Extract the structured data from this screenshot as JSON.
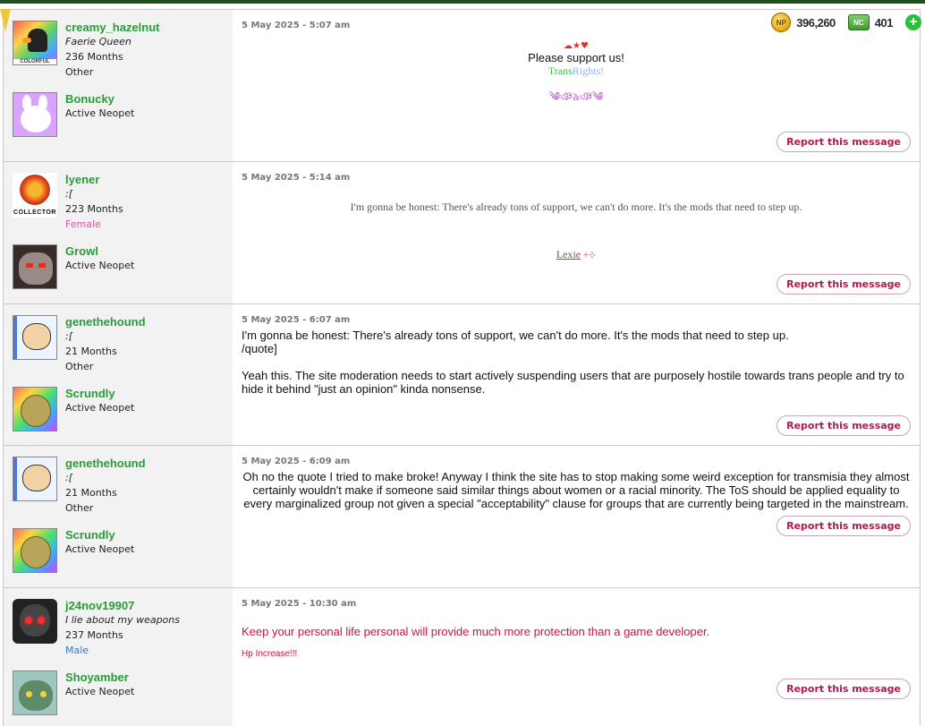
{
  "hud": {
    "neopoints": "396,260",
    "neocash": "401",
    "np_icon": "np-coin-icon",
    "nc_icon": "nc-cash-icon"
  },
  "report_label": "Report this message",
  "posts": [
    {
      "date": "5 May 2025 - 5:07 am",
      "user": {
        "name": "creamy_hazelnut",
        "title": "Faerie Queen",
        "months": "236 Months",
        "gender": "Other"
      },
      "pet": {
        "name": "Bonucky",
        "status": "Active Neopet"
      },
      "sig_icons": "☁★♥",
      "support": "Please support us!",
      "trans_word1": "Trans",
      "trans_word2": "Rights!",
      "flourish": "༄ঞ৯ঞ༄"
    },
    {
      "date": "5 May 2025 - 5:14 am",
      "user": {
        "name": "lyener",
        "title": ":[",
        "months": "223 Months",
        "gender": "Female"
      },
      "pet": {
        "name": "Growl",
        "status": "Active Neopet"
      },
      "body": "I'm gonna be honest: There's already tons of support, we can't do more. It's the mods that need to step up.",
      "sig_name": "Lexie",
      "sig_deco": "+⊹"
    },
    {
      "date": "5 May 2025 - 6:07 am",
      "user": {
        "name": "genethehound",
        "title": ":[",
        "months": "21 Months",
        "gender": "Other"
      },
      "pet": {
        "name": "Scrundly",
        "status": "Active Neopet"
      },
      "quote": "I'm gonna be honest: There's already tons of support, we can't do more. It's the mods that need to step up.",
      "quote_end": "/quote]",
      "body": "Yeah this. The site moderation needs to start actively suspending users that are purposely hostile towards trans people and try to hide it behind \"just an opinion\" kinda nonsense."
    },
    {
      "date": "5 May 2025 - 6:09 am",
      "user": {
        "name": "genethehound",
        "title": ":[",
        "months": "21 Months",
        "gender": "Other"
      },
      "pet": {
        "name": "Scrundly",
        "status": "Active Neopet"
      },
      "body": "Oh no the quote I tried to make broke! Anyway I think the site has to stop making some weird exception for transmisia they almost certainly wouldn't make if someone said similar things about women or a racial minority. The ToS should be applied equality to every marginalized group not given a special \"acceptability\" clause for groups that are currently being targeted in the mainstream."
    },
    {
      "date": "5 May 2025 - 10:30 am",
      "user": {
        "name": "j24nov19907",
        "title": "I lie about my weapons",
        "months": "237 Months",
        "gender": "Male"
      },
      "pet": {
        "name": "Shoyamber",
        "status": "Active Neopet"
      },
      "body": "Keep your personal life personal will provide much more protection than a game developer.",
      "sig": "Hp Increase!!!"
    }
  ]
}
